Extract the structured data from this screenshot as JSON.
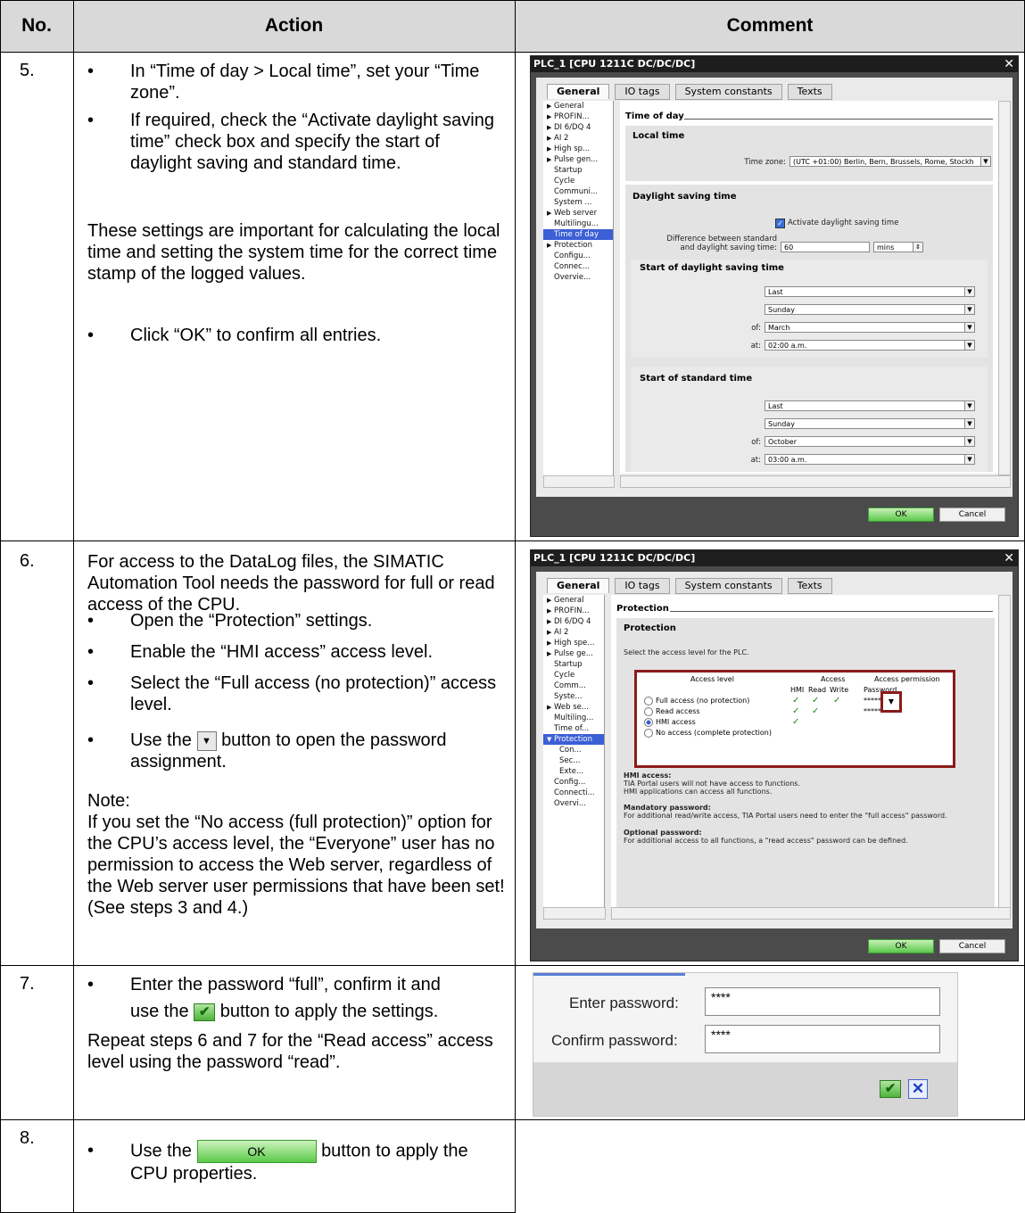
{
  "header": {
    "no": "No.",
    "action": "Action",
    "comment": "Comment"
  },
  "rows": [
    {
      "no": "5.",
      "bullets_a": [
        "In “Time of day > Local time”, set your “Time zone”.",
        "If required, check the “Activate daylight saving time” check box and specify the start of daylight saving and standard time."
      ],
      "para": "These settings are important for calculating the local time and setting the system time for the correct time stamp of the logged values.",
      "bullet_b": "Click “OK” to confirm all entries."
    },
    {
      "no": "6.",
      "intro": "For access to the DataLog files, the SIMATIC Automation Tool needs the password for full or read access of the CPU.",
      "bullets": [
        "Open the “Protection” settings.",
        "Enable the “HMI access” access level.",
        "Select the “Full access (no protection)” access level."
      ],
      "bullet_btn_pre": "Use the",
      "bullet_btn_post": "button to open the password assignment.",
      "note_label": "Note:",
      "note": "If you set the “No access (full protection)” option for the CPU’s access level, the “Everyone” user has no permission to access the Web server, regardless of the Web server user permissions that have been set! (See steps 3 and 4.)"
    },
    {
      "no": "7.",
      "bullet_pre": "Enter the password “full”, confirm it and",
      "bullet_use": "use the",
      "bullet_post": "button to apply the settings.",
      "para": "Repeat steps 6 and 7 for the “Read access” access level using the password “read”."
    },
    {
      "no": "8.",
      "bullet_pre": "Use the",
      "ok_label": "OK",
      "bullet_post": "button to apply the CPU properties."
    }
  ],
  "dialog1": {
    "title": "PLC_1 [CPU 1211C DC/DC/DC]",
    "tabs": [
      "General",
      "IO tags",
      "System constants",
      "Texts"
    ],
    "nav": [
      "General",
      "PROFIN...",
      "DI 6/DQ 4",
      "AI 2",
      "High sp...",
      "Pulse gen...",
      "Startup",
      "Cycle",
      "Communi...",
      "System ...",
      "Web server",
      "Multilingu...",
      "Time of day",
      "Protection",
      "Configu...",
      "Connec...",
      "Overvie..."
    ],
    "section_title": "Time of day",
    "local_time": "Local time",
    "time_zone_label": "Time zone:",
    "time_zone_value": "(UTC +01:00) Berlin, Bern, Brussels, Rome, Stockh",
    "dst_title": "Daylight saving time",
    "activate_dst": "Activate daylight saving time",
    "diff_label_1": "Difference between standard",
    "diff_label_2": "and daylight saving time:",
    "diff_value": "60",
    "diff_unit": "mins",
    "start_dst": "Start of daylight saving time",
    "dst_fields": [
      "Last",
      "Sunday",
      "March",
      "02:00 a.m."
    ],
    "start_std": "Start of standard time",
    "std_fields": [
      "Last",
      "Sunday",
      "October",
      "03:00 a.m."
    ],
    "of_label": "of:",
    "at_label": "at:",
    "ok": "OK",
    "cancel": "Cancel"
  },
  "dialog2": {
    "title": "PLC_1 [CPU 1211C DC/DC/DC]",
    "tabs": [
      "General",
      "IO tags",
      "System constants",
      "Texts"
    ],
    "nav": [
      "General",
      "PROFIN...",
      "DI 6/DQ 4",
      "AI 2",
      "High spe...",
      "Pulse ge...",
      "Startup",
      "Cycle",
      "Comm...",
      "Syste...",
      "Web se...",
      "Multiling...",
      "Time of...",
      "Protection",
      "Con...",
      "Sec...",
      "Exte...",
      "Config...",
      "Connecti...",
      "Overvi..."
    ],
    "section_title": "Protection",
    "sub_title": "Protection",
    "select_text": "Select the access level for the PLC.",
    "col_level": "Access level",
    "col_access": "Access",
    "col_perm": "Access permission",
    "sub_hmi": "HMI",
    "sub_read": "Read",
    "sub_write": "Write",
    "sub_pw": "Password",
    "levels": [
      "Full access (no protection)",
      "Read access",
      "HMI access",
      "No access (complete protection)"
    ],
    "pw_mask": "********",
    "info": [
      {
        "head": "HMI access:",
        "lines": [
          "TIA Portal users will not have access to functions.",
          "HMI applications can access all functions."
        ]
      },
      {
        "head": "Mandatory password:",
        "lines": [
          "For additional read/write access, TIA Portal users need to enter the \"full access\" password."
        ]
      },
      {
        "head": "Optional password:",
        "lines": [
          "For additional access to all functions, a \"read access\" password can be defined."
        ]
      }
    ],
    "ok": "OK",
    "cancel": "Cancel"
  },
  "pw_dialog": {
    "enter_label": "Enter password:",
    "enter_value": "****",
    "confirm_label": "Confirm password:",
    "confirm_value": "****"
  }
}
